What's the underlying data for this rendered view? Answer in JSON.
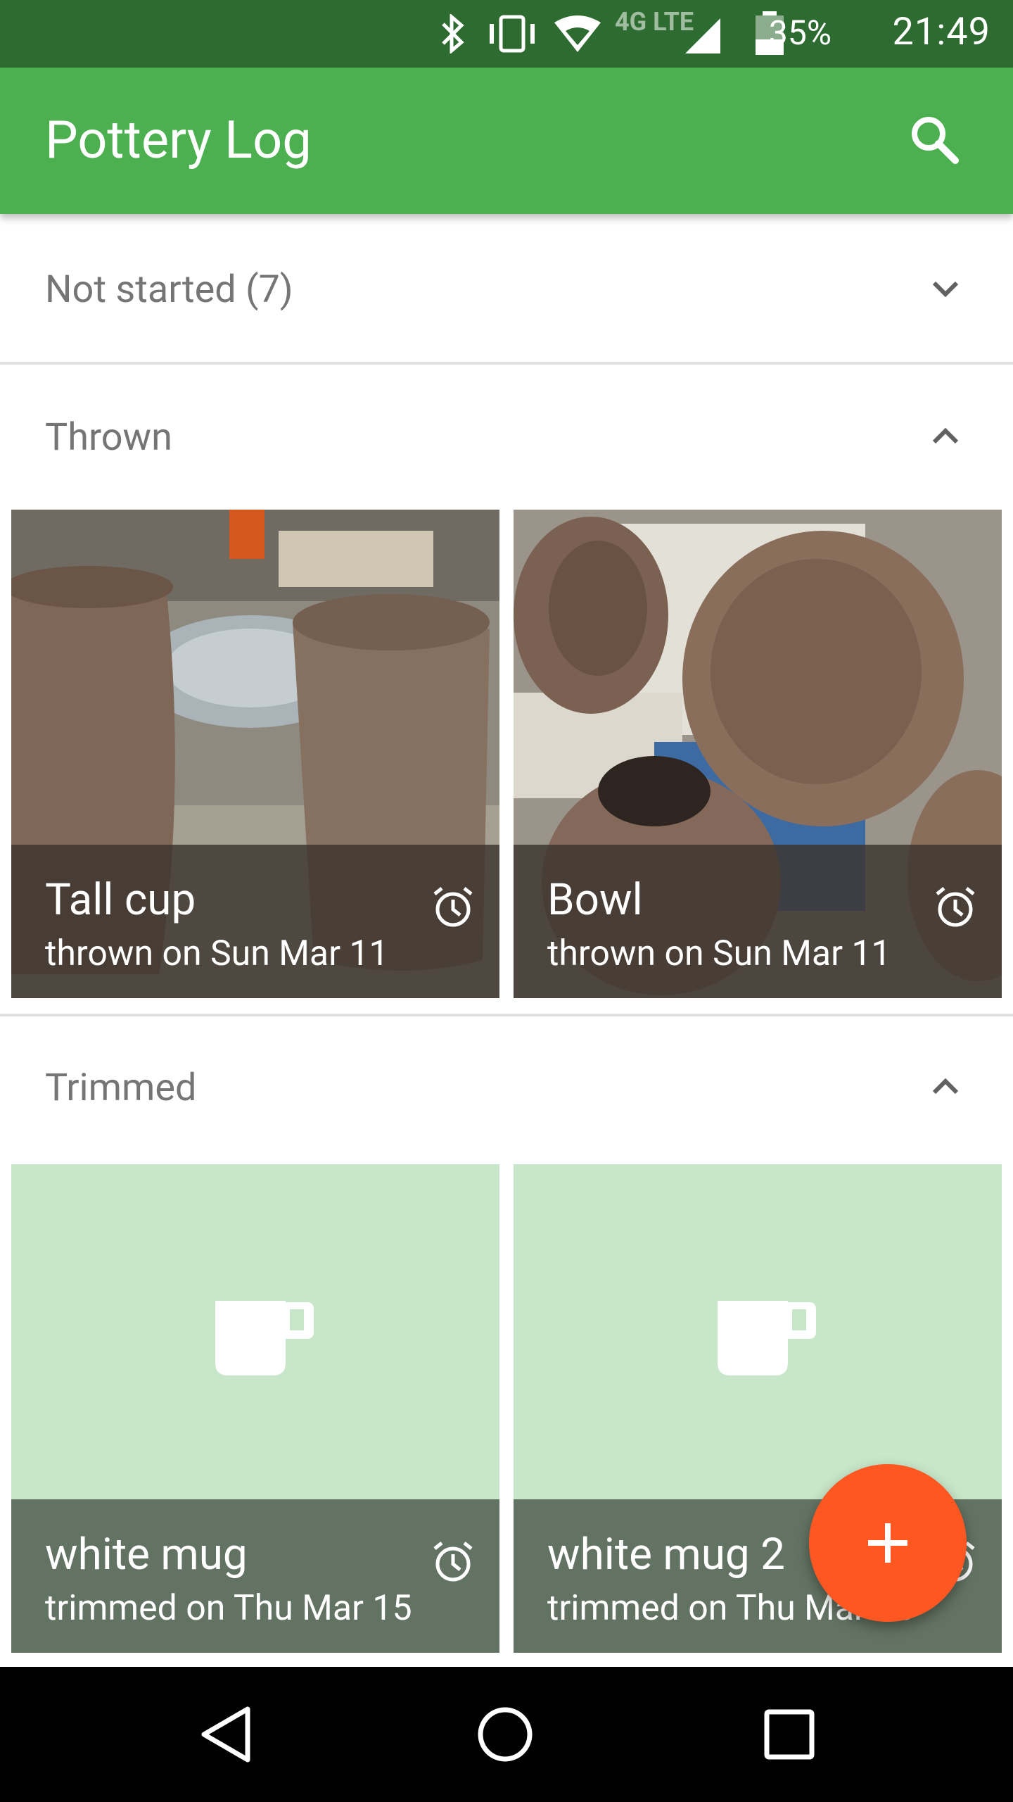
{
  "status_bar": {
    "battery_percent": "35%",
    "time": "21:49",
    "network_label": "4G LTE",
    "icons": [
      "bluetooth-icon",
      "vibrate-icon",
      "wifi-icon",
      "network-icon",
      "signal-icon",
      "battery-icon"
    ]
  },
  "app_bar": {
    "title": "Pottery Log",
    "search_icon": "search-icon"
  },
  "sections": [
    {
      "label": "Not started (7)",
      "expanded": false
    },
    {
      "label": "Thrown",
      "expanded": true
    },
    {
      "label": "Trimmed",
      "expanded": true
    }
  ],
  "thrown_cards": [
    {
      "name": "Tall cup",
      "subtitle": "thrown on Sun Mar 11"
    },
    {
      "name": "Bowl",
      "subtitle": "thrown on Sun Mar 11"
    }
  ],
  "trimmed_cards": [
    {
      "name": "white mug",
      "subtitle": "trimmed on Thu Mar 15"
    },
    {
      "name": "white mug 2",
      "subtitle": "trimmed on Thu Mar 15"
    }
  ],
  "fab": {
    "icon": "plus-icon"
  },
  "nav_bar": {
    "icons": [
      "back-icon",
      "home-icon",
      "recents-icon"
    ]
  },
  "colors": {
    "status_bar": "#2e6b30",
    "app_bar": "#4caf50",
    "fab": "#ff5722",
    "placeholder_bg": "#c8e6c9",
    "placeholder_footer": "#637363"
  }
}
